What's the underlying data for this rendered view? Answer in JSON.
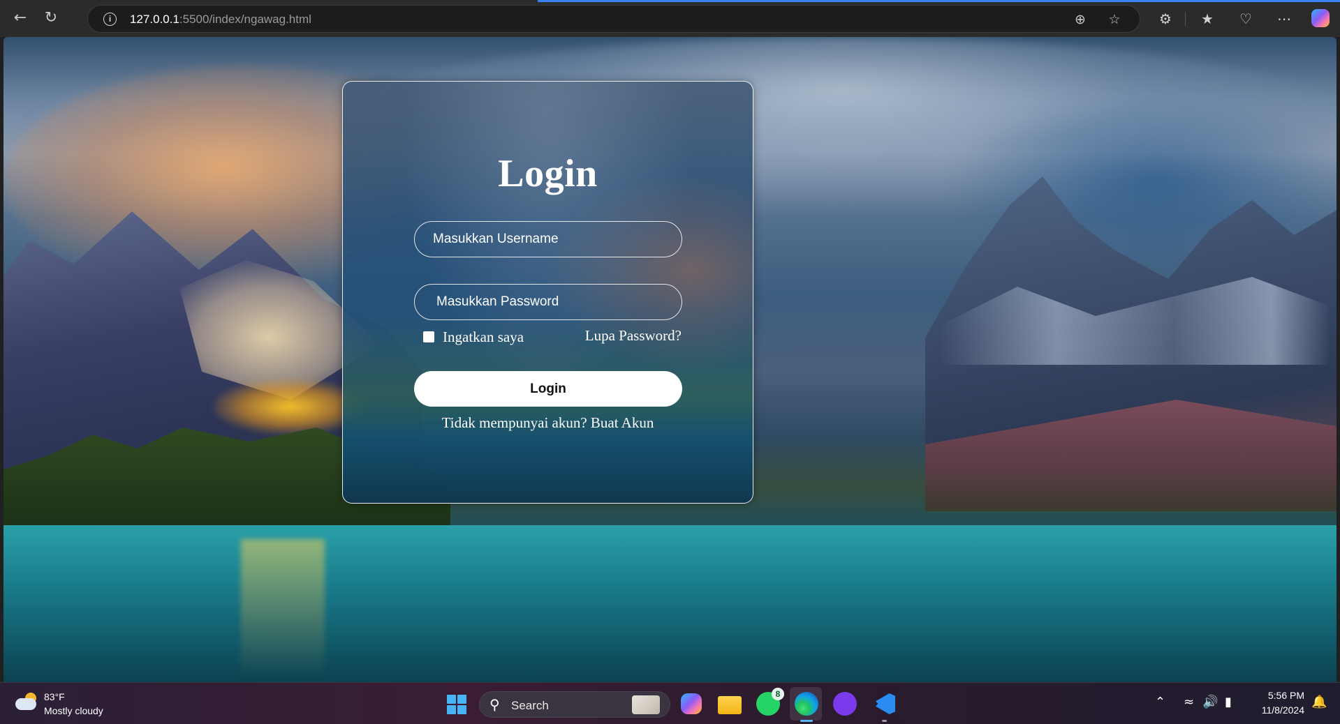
{
  "browser": {
    "url_host": "127.0.0.1",
    "url_rest": ":5500/index/ngawag.html",
    "accent_color": "#3b82f6"
  },
  "page": {
    "title": "Login",
    "username_placeholder": "Masukkan Username",
    "password_placeholder": "Masukkan Password",
    "remember_label": "Ingatkan saya",
    "forgot_label": "Lupa Password?",
    "login_button": "Login",
    "signup_prefix": "Tidak mempunyai akun?",
    "signup_link": "Buat Akun"
  },
  "taskbar": {
    "temperature": "83°F",
    "condition": "Mostly cloudy",
    "search_label": "Search",
    "whatsapp_badge": "8",
    "time": "5:56 PM",
    "date": "11/8/2024"
  },
  "icons": {
    "back": "arrow-left-icon",
    "refresh": "refresh-icon",
    "info": "info-icon",
    "zoom": "zoom-icon",
    "favorite": "star-icon",
    "extensions": "puzzle-icon",
    "favorites": "favorites-icon",
    "health": "heart-pulse-icon",
    "more": "more-icon"
  }
}
